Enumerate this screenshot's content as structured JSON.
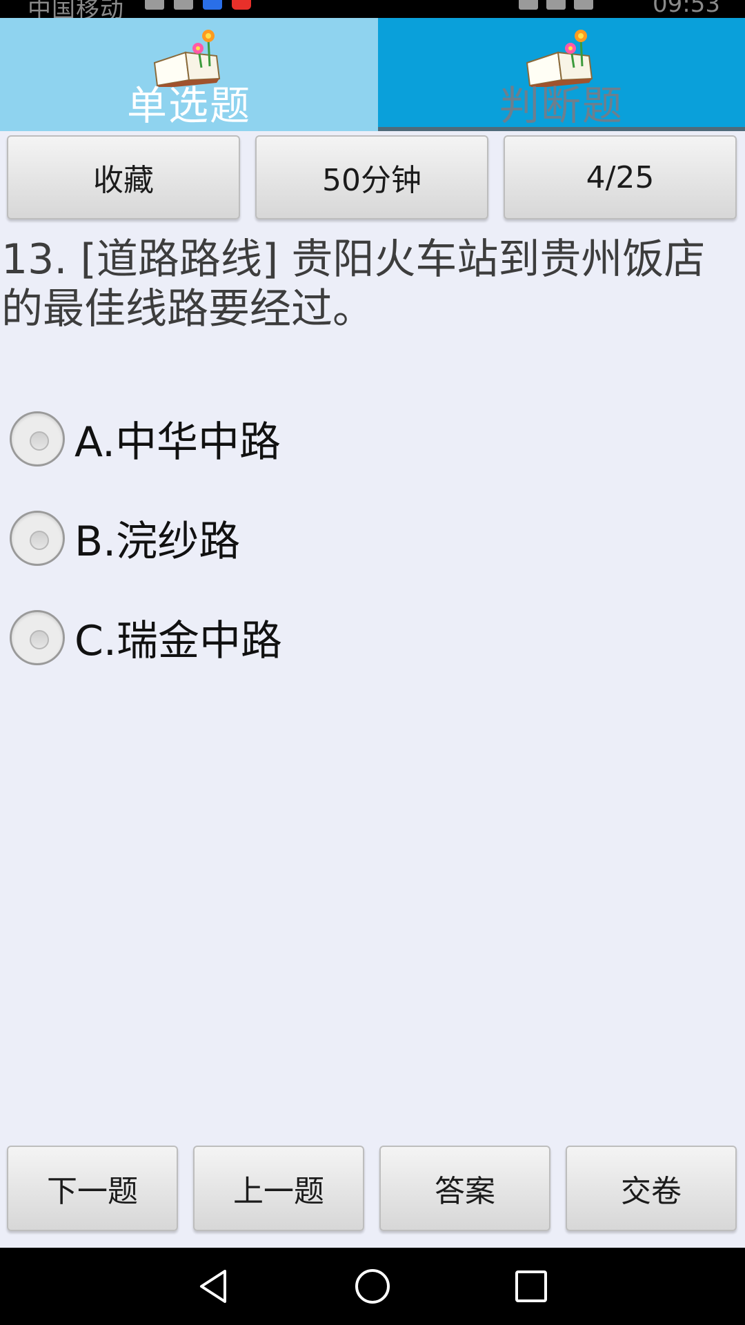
{
  "status_bar": {
    "carrier": "中国移动",
    "time": "09:53"
  },
  "tabs": [
    {
      "label": "单选题",
      "icon": "book-flower-icon",
      "selected": true
    },
    {
      "label": "判断题",
      "icon": "book-flower-icon",
      "selected": false
    }
  ],
  "toolbar": {
    "favorite_label": "收藏",
    "timer_label": "50分钟",
    "progress_label": "4/25"
  },
  "question": {
    "text": "13. [道路路线] 贵阳火车站到贵州饭店的最佳线路要经过。",
    "options": [
      {
        "label": "A.中华中路"
      },
      {
        "label": "B.浣纱路"
      },
      {
        "label": "C.瑞金中路"
      }
    ]
  },
  "bottom_buttons": {
    "next_label": "下一题",
    "prev_label": "上一题",
    "answer_label": "答案",
    "submit_label": "交卷"
  },
  "navbar": {
    "back_icon": "back-triangle-icon",
    "home_icon": "home-circle-icon",
    "recents_icon": "recents-square-icon"
  },
  "colors": {
    "tab_selected_bg": "#8fd3ef",
    "tab_unselected_bg": "#0aa0da",
    "page_bg": "#eceef8"
  }
}
